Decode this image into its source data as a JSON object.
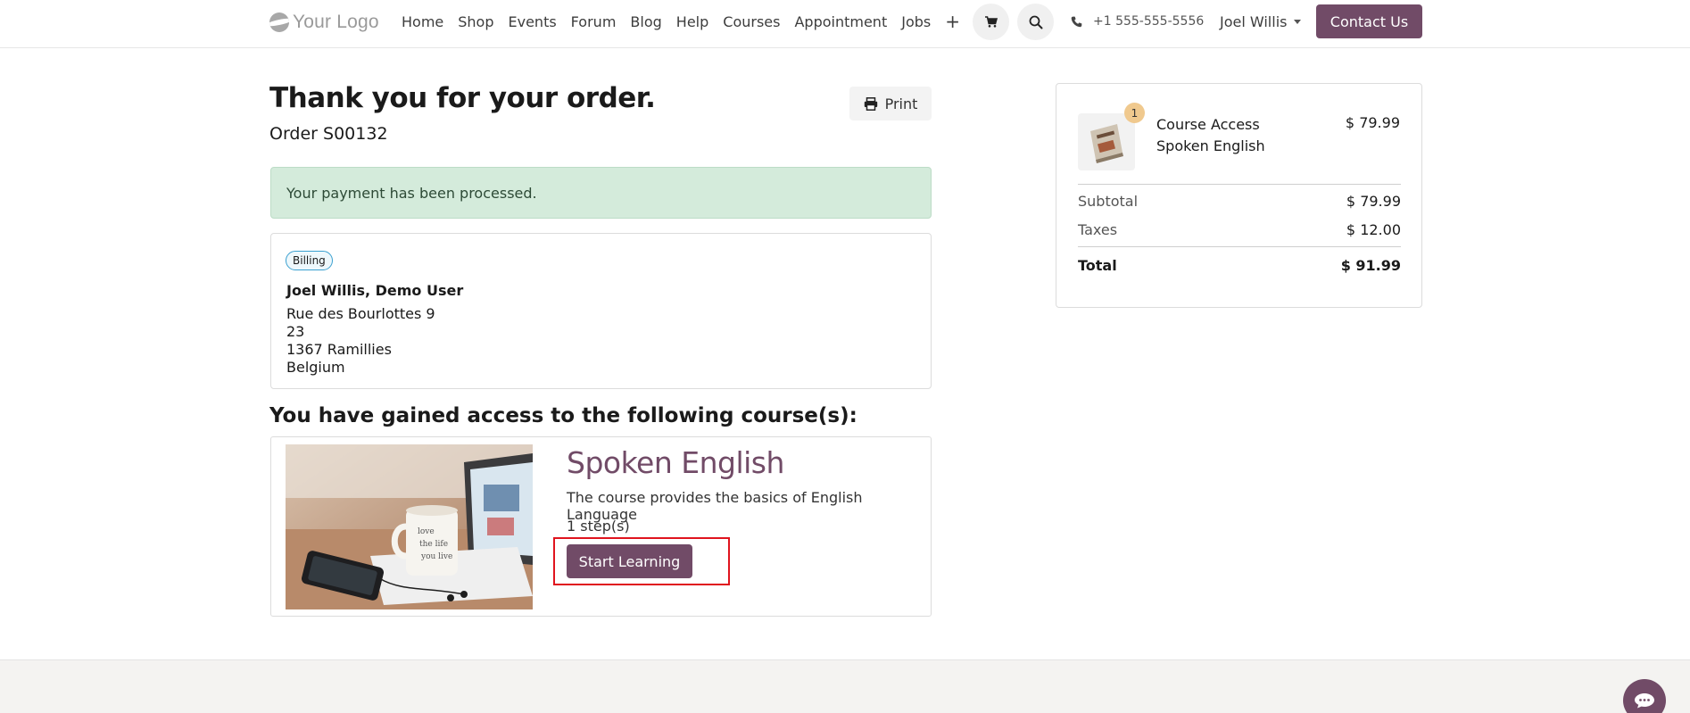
{
  "header": {
    "logo_text": "Your Logo",
    "nav": [
      "Home",
      "Shop",
      "Events",
      "Forum",
      "Blog",
      "Help",
      "Courses",
      "Appointment",
      "Jobs"
    ],
    "add_icon": "+",
    "phone": "+1 555-555-5556",
    "user_name": "Joel Willis",
    "contact_label": "Contact Us"
  },
  "order": {
    "title": "Thank you for your order.",
    "reference": "Order S00132",
    "print_label": "Print",
    "payment_message": "Your payment has been processed."
  },
  "billing": {
    "badge": "Billing",
    "name": "Joel Willis, Demo User",
    "address": [
      "Rue des Bourlottes 9",
      "23",
      "1367 Ramillies",
      "Belgium"
    ]
  },
  "courses": {
    "heading": "You have gained access to the following course(s):",
    "items": [
      {
        "title": "Spoken English",
        "description": "The course provides the basics of English Language",
        "steps": "1 step(s)",
        "cta": "Start Learning"
      }
    ]
  },
  "summary": {
    "item": {
      "quantity": "1",
      "name_line1": "Course Access",
      "name_line2": "Spoken English",
      "price": "$ 79.99"
    },
    "subtotal_label": "Subtotal",
    "subtotal": "$ 79.99",
    "taxes_label": "Taxes",
    "taxes": "$ 12.00",
    "total_label": "Total",
    "total": "$ 91.99"
  },
  "colors": {
    "brand": "#714b67",
    "success_bg": "#d4ebdb",
    "highlight": "#e0141e"
  },
  "icons": {
    "cart": "cart-icon",
    "search": "search-icon",
    "phone": "phone-icon",
    "print": "printer-icon",
    "chat": "chat-icon"
  }
}
